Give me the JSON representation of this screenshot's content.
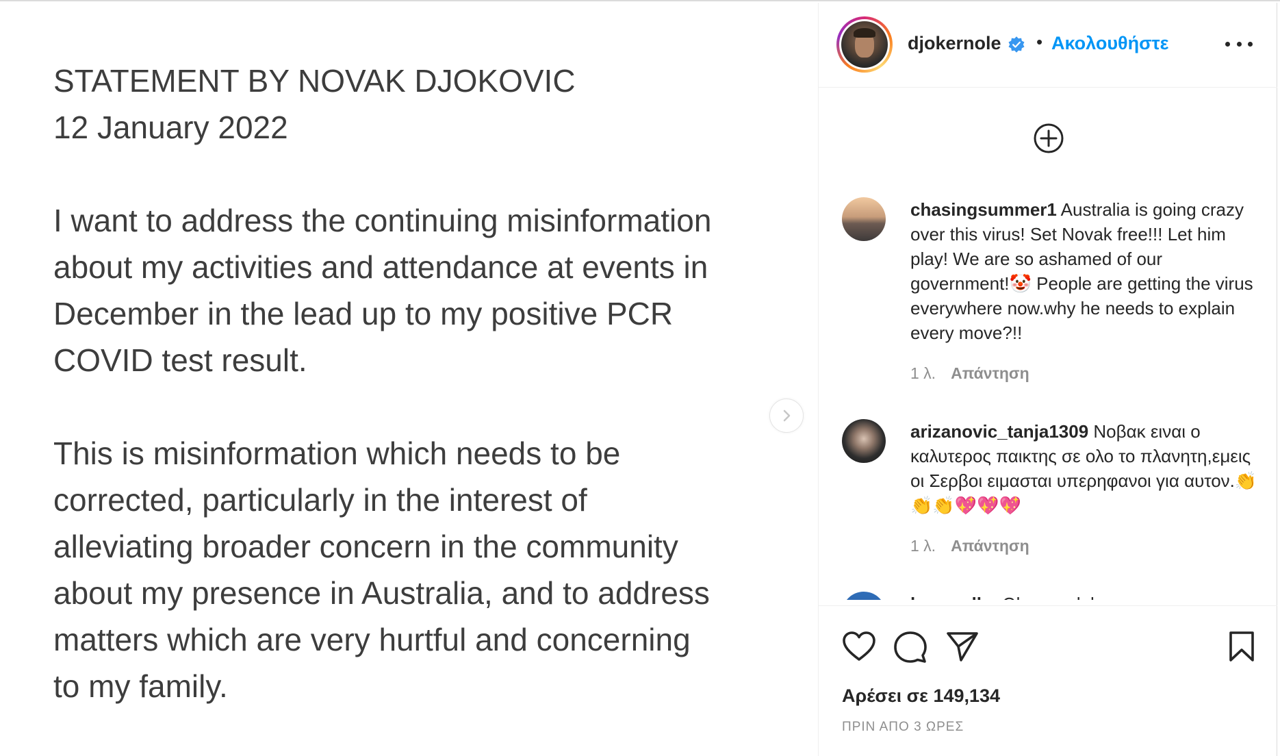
{
  "post": {
    "statement": {
      "heading_1": "STATEMENT BY NOVAK DJOKOVIC",
      "heading_2": "12 January 2022",
      "paragraph_1_lines": [
        "I want to address the continuing misinformation",
        "about my activities and attendance at events in",
        "December in the lead up to my positive PCR",
        "COVID test result."
      ],
      "paragraph_2_lines": [
        "This is misinformation which needs to be",
        "corrected, particularly in the interest of",
        "alleviating broader concern in the community",
        "about my presence in Australia, and to address",
        "matters which are very hurtful and concerning",
        "to my family."
      ]
    }
  },
  "header": {
    "username": "djokernole",
    "separator": "•",
    "follow_label": "Ακολουθήστε"
  },
  "comments": [
    {
      "username": "chasingsummer1",
      "text": " Australia is going crazy over this virus! Set Novak free!!! Let him play! We are so ashamed of our government!🤡 People are getting the virus everywhere now.why he needs to explain every move?!!",
      "time": "1 λ.",
      "reply_label": "Απάντηση"
    },
    {
      "username": "arizanovic_tanja1309",
      "text": " Νοβακ ειναι ο καλυτερος παικτης σε ολο το πλανητη,εμεις οι Σερβοι ειμασται υπερηφανοι για αυτον.👏👏👏💖💖💖",
      "time": "1 λ.",
      "reply_label": "Απάντηση"
    },
    {
      "username": "bernardba",
      "text": " Ok pero debes ...",
      "time": "",
      "reply_label": ""
    }
  ],
  "footer": {
    "likes_text": "Αρέσει σε 149,134",
    "time_ago": "ΠΡΙΝ ΑΠΟ 3 ΩΡΕΣ"
  },
  "colors": {
    "accent": "#0095f6",
    "text": "#262626",
    "muted": "#8e8e8e",
    "verified": "#3897f0"
  }
}
